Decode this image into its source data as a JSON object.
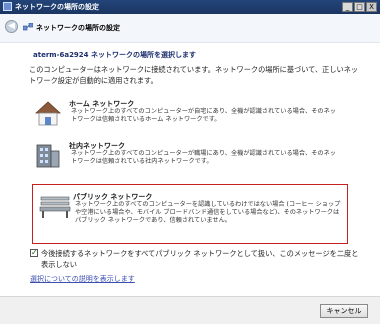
{
  "window": {
    "title": "ネットワークの場所の設定",
    "buttons": [
      "_",
      "□",
      "X"
    ]
  },
  "header": {
    "title": "ネットワークの場所の設定"
  },
  "content": {
    "subtitle": "aterm-6a2924 ネットワークの場所を選択します",
    "description": "このコンピューターはネットワークに接続されています。ネットワークの場所に基づいて、正しいネットワーク設定が自動的に適用されます。",
    "options": [
      {
        "title": "ホーム ネットワーク",
        "text": "ネットワーク上のすべてのコンピューターが自宅にあり、全機が認識されている場合、そのネットワークは信頼されているホーム ネットワークです。"
      },
      {
        "title": "社内ネットワーク",
        "text": "ネットワーク上のすべてのコンピューターが職場にあり、全機が認識されている場合、そのネットワークは信頼されている社内ネットワークです。"
      },
      {
        "title": "パブリック ネットワーク",
        "text": "ネットワーク上のすべてのコンピューターを認識しているわけではない場合 (コーヒー ショップや空港にいる場合や、モバイル ブロードバンド通信をしている場合など)、そのネットワークはパブリック ネットワークであり、信頼されていません。"
      }
    ],
    "checkbox_label": "今後接続するネットワークをすべてパブリック ネットワークとして扱い、このメッセージを二度と表示しない",
    "help_link": "選択についての説明を表示します"
  },
  "footer": {
    "cancel_label": "キャンセル"
  }
}
